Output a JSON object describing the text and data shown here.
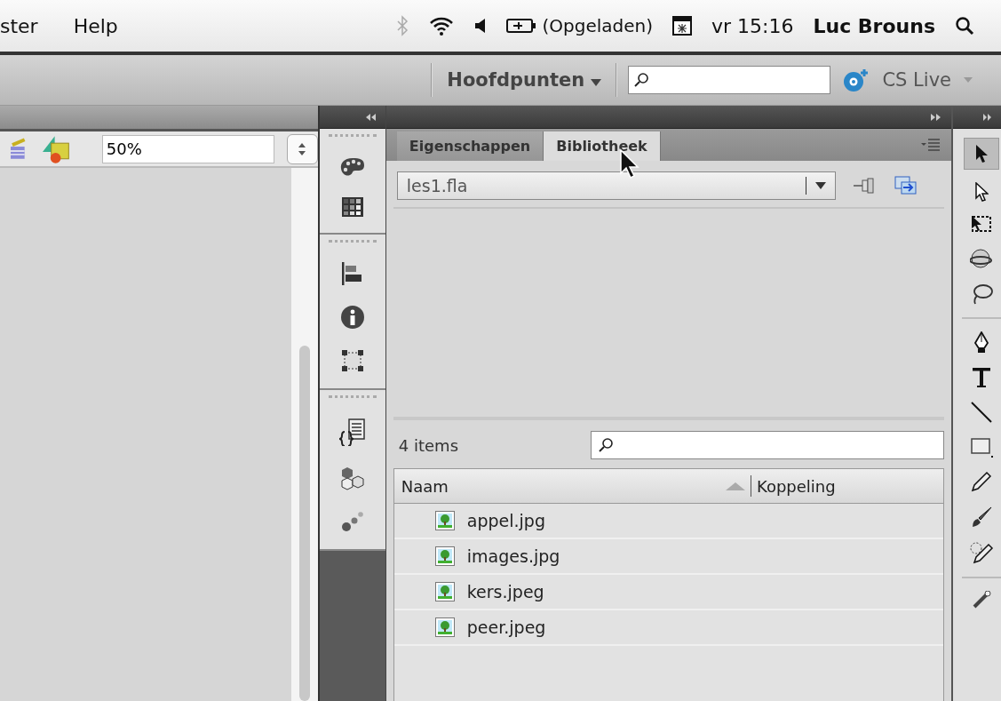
{
  "menubar": {
    "items": [
      "ster",
      "Help"
    ],
    "battery": "(Opgeladen)",
    "clock": "vr 15:16",
    "user": "Luc Brouns"
  },
  "toolbar": {
    "workspace": "Hoofdpunten",
    "cs_live": "CS Live"
  },
  "stage": {
    "zoom": "50%"
  },
  "library": {
    "tabs": [
      {
        "label": "Eigenschappen",
        "selected": false
      },
      {
        "label": "Bibliotheek",
        "selected": true
      }
    ],
    "document": "les1.fla",
    "count": "4 items",
    "columns": [
      "Naam",
      "Koppeling"
    ],
    "items": [
      {
        "name": "appel.jpg"
      },
      {
        "name": "images.jpg"
      },
      {
        "name": "kers.jpeg"
      },
      {
        "name": "peer.jpeg"
      }
    ]
  }
}
